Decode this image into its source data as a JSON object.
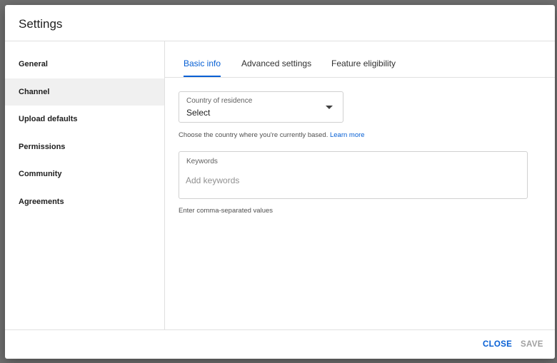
{
  "dialog": {
    "title": "Settings"
  },
  "sidebar": {
    "items": [
      {
        "label": "General"
      },
      {
        "label": "Channel"
      },
      {
        "label": "Upload defaults"
      },
      {
        "label": "Permissions"
      },
      {
        "label": "Community"
      },
      {
        "label": "Agreements"
      }
    ],
    "active": "Channel"
  },
  "tabs": {
    "items": [
      {
        "label": "Basic info"
      },
      {
        "label": "Advanced settings"
      },
      {
        "label": "Feature eligibility"
      }
    ],
    "active": "Basic info"
  },
  "country": {
    "label": "Country of residence",
    "value": "Select",
    "helper": "Choose the country where you're currently based.",
    "helper_link": "Learn more"
  },
  "keywords": {
    "label": "Keywords",
    "placeholder": "Add keywords",
    "value": "",
    "helper": "Enter comma-separated values"
  },
  "footer": {
    "close_label": "CLOSE",
    "save_label": "SAVE"
  },
  "colors": {
    "accent": "#065fd4",
    "disabled": "#a0a0a0",
    "active_sidebar_bg": "#f0f0f0"
  }
}
